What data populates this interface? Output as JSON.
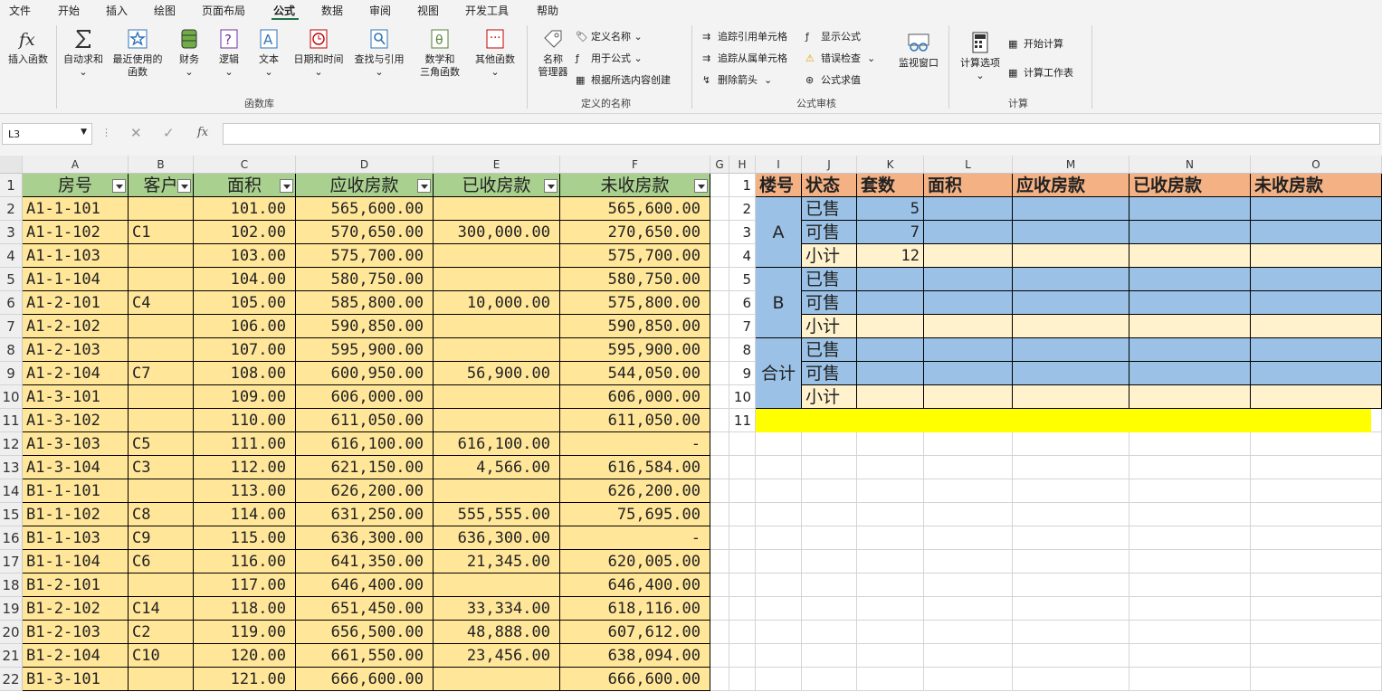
{
  "menu": [
    "文件",
    "开始",
    "插入",
    "绘图",
    "页面布局",
    "公式",
    "数据",
    "审阅",
    "视图",
    "开发工具",
    "帮助"
  ],
  "active_menu": "公式",
  "ribbon": {
    "func_lib": {
      "insert_function": "插入函数",
      "autosum": "自动求和",
      "recent_1": "最近使用的",
      "recent_2": "函数",
      "financial": "财务",
      "logical": "逻辑",
      "text": "文本",
      "datetime": "日期和时间",
      "lookup": "查找与引用",
      "math_1": "数学和",
      "math_2": "三角函数",
      "more": "其他函数",
      "group": "函数库"
    },
    "names": {
      "manager_1": "名称",
      "manager_2": "管理器",
      "define": "定义名称",
      "use_in_formula": "用于公式",
      "create_from_sel": "根据所选内容创建",
      "group": "定义的名称"
    },
    "audit": {
      "trace_prec": "追踪引用单元格",
      "trace_dep": "追踪从属单元格",
      "remove_arrows": "删除箭头",
      "show_formulas": "显示公式",
      "error_check": "错误检查",
      "evaluate": "公式求值",
      "watch": "监视窗口",
      "group": "公式审核"
    },
    "calc": {
      "options": "计算选项",
      "calc_now": "开始计算",
      "calc_sheet": "计算工作表",
      "group": "计算"
    }
  },
  "formula_bar": {
    "name_box": "L3",
    "fx": "fx",
    "formula": ""
  },
  "columns": [
    "A",
    "B",
    "C",
    "D",
    "E",
    "F",
    "G",
    "H",
    "I",
    "J",
    "K",
    "L",
    "M",
    "N",
    "O"
  ],
  "rows": [
    "1",
    "2",
    "3",
    "4",
    "5",
    "6",
    "7",
    "8",
    "9",
    "10",
    "11",
    "12",
    "13",
    "14",
    "15",
    "16",
    "17",
    "18",
    "19",
    "20",
    "21",
    "22"
  ],
  "left_table": {
    "headers": [
      "房号",
      "客户",
      "面积",
      "应收房款",
      "已收房款",
      "未收房款"
    ],
    "rows": [
      [
        "A1-1-101",
        "",
        "101.00",
        "565,600.00",
        "",
        "565,600.00"
      ],
      [
        "A1-1-102",
        "C1",
        "102.00",
        "570,650.00",
        "300,000.00",
        "270,650.00"
      ],
      [
        "A1-1-103",
        "",
        "103.00",
        "575,700.00",
        "",
        "575,700.00"
      ],
      [
        "A1-1-104",
        "",
        "104.00",
        "580,750.00",
        "",
        "580,750.00"
      ],
      [
        "A1-2-101",
        "C4",
        "105.00",
        "585,800.00",
        "10,000.00",
        "575,800.00"
      ],
      [
        "A1-2-102",
        "",
        "106.00",
        "590,850.00",
        "",
        "590,850.00"
      ],
      [
        "A1-2-103",
        "",
        "107.00",
        "595,900.00",
        "",
        "595,900.00"
      ],
      [
        "A1-2-104",
        "C7",
        "108.00",
        "600,950.00",
        "56,900.00",
        "544,050.00"
      ],
      [
        "A1-3-101",
        "",
        "109.00",
        "606,000.00",
        "",
        "606,000.00"
      ],
      [
        "A1-3-102",
        "",
        "110.00",
        "611,050.00",
        "",
        "611,050.00"
      ],
      [
        "A1-3-103",
        "C5",
        "111.00",
        "616,100.00",
        "616,100.00",
        "-"
      ],
      [
        "A1-3-104",
        "C3",
        "112.00",
        "621,150.00",
        "4,566.00",
        "616,584.00"
      ],
      [
        "B1-1-101",
        "",
        "113.00",
        "626,200.00",
        "",
        "626,200.00"
      ],
      [
        "B1-1-102",
        "C8",
        "114.00",
        "631,250.00",
        "555,555.00",
        "75,695.00"
      ],
      [
        "B1-1-103",
        "C9",
        "115.00",
        "636,300.00",
        "636,300.00",
        "-"
      ],
      [
        "B1-1-104",
        "C6",
        "116.00",
        "641,350.00",
        "21,345.00",
        "620,005.00"
      ],
      [
        "B1-2-101",
        "",
        "117.00",
        "646,400.00",
        "",
        "646,400.00"
      ],
      [
        "B1-2-102",
        "C14",
        "118.00",
        "651,450.00",
        "33,334.00",
        "618,116.00"
      ],
      [
        "B1-2-103",
        "C2",
        "119.00",
        "656,500.00",
        "48,888.00",
        "607,612.00"
      ],
      [
        "B1-2-104",
        "C10",
        "120.00",
        "661,550.00",
        "23,456.00",
        "638,094.00"
      ],
      [
        "B1-3-101",
        "",
        "121.00",
        "666,600.00",
        "",
        "666,600.00"
      ]
    ]
  },
  "right_table": {
    "row_nums": [
      "1",
      "2",
      "3",
      "4",
      "5",
      "6",
      "7",
      "8",
      "9",
      "10",
      "11"
    ],
    "headers": [
      "楼号",
      "状态",
      "套数",
      "面积",
      "应收房款",
      "已收房款",
      "未收房款"
    ],
    "groups": [
      "A",
      "B",
      "合计"
    ],
    "status": [
      "已售",
      "可售",
      "小计"
    ],
    "counts": [
      "5",
      "7",
      "12"
    ]
  },
  "colors": {
    "green_header": "#a9d08e",
    "yellow_data": "#ffe699",
    "orange_header": "#f4b183",
    "blue": "#9bc2e6",
    "light_yellow": "#fff2cc",
    "highlight": "#ffff00"
  }
}
